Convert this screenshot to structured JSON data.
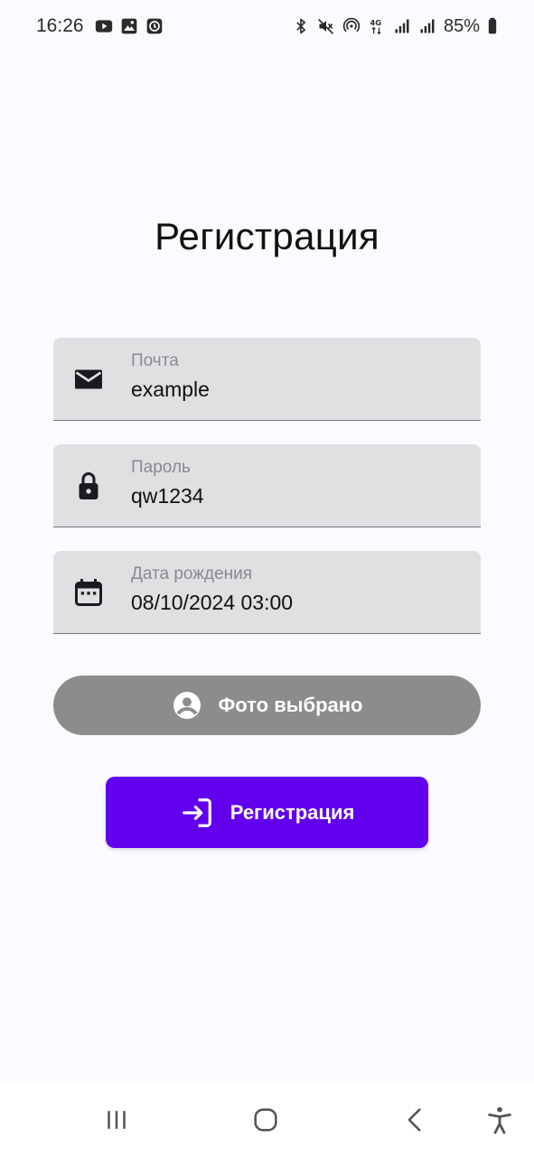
{
  "status_bar": {
    "time": "16:26",
    "battery_percent": "85%",
    "left_icons": [
      "youtube-icon",
      "gallery-icon",
      "clock-app-icon"
    ],
    "right_icons": [
      "bluetooth-icon",
      "mute-icon",
      "hotspot-icon",
      "4g-icon",
      "signal-icon",
      "signal-icon",
      "battery-icon"
    ]
  },
  "page": {
    "title": "Регистрация"
  },
  "form": {
    "email": {
      "label": "Почта",
      "value": "example",
      "icon": "mail-icon"
    },
    "password": {
      "label": "Пароль",
      "value": "qw1234",
      "icon": "lock-icon"
    },
    "birth_date": {
      "label": "Дата рождения",
      "value": "08/10/2024 03:00",
      "icon": "calendar-icon"
    }
  },
  "buttons": {
    "photo_label": "Фото выбрано",
    "photo_icon": "account-circle-icon",
    "register_label": "Регистрация",
    "register_icon": "login-icon"
  },
  "colors": {
    "background": "#fbfafe",
    "field_background": "#e0e0e3",
    "photo_button": "#8c8c8c",
    "primary": "#6200ee"
  },
  "nav_bar": {
    "icons": [
      "recent-apps-icon",
      "home-icon",
      "back-icon",
      "accessibility-icon"
    ]
  }
}
